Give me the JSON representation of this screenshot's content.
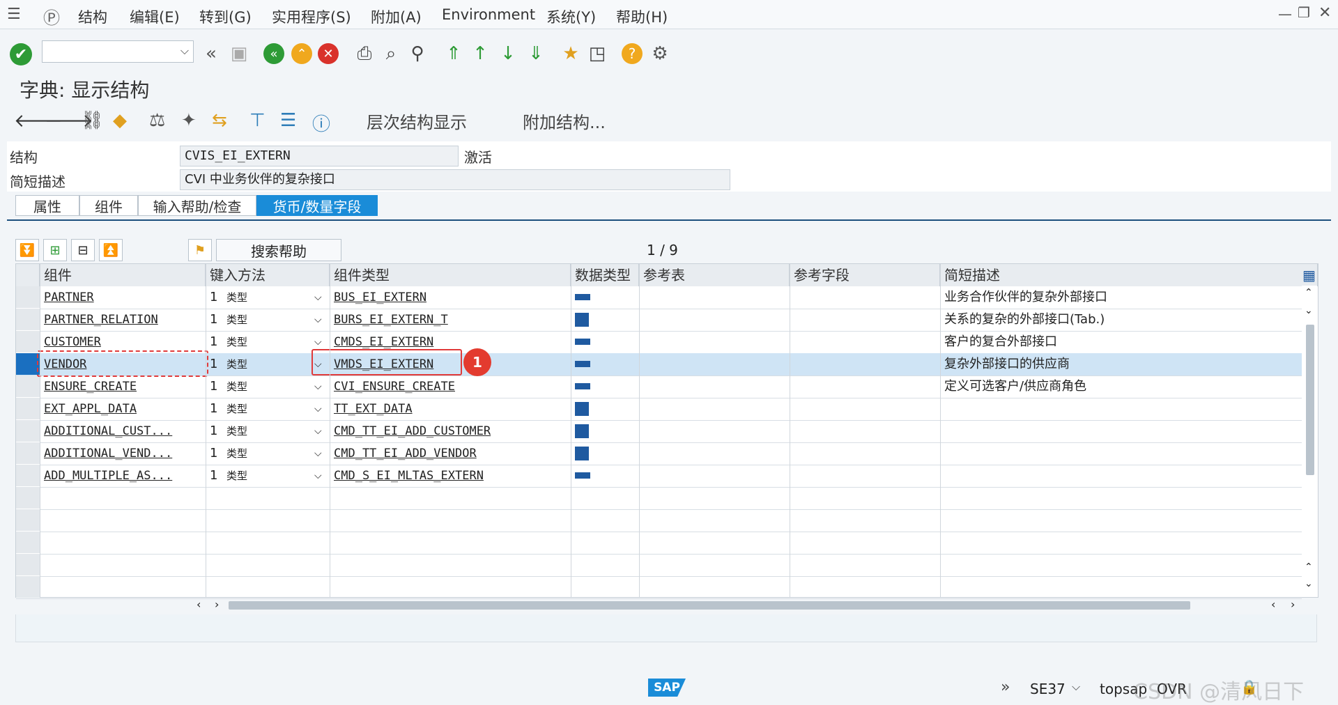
{
  "menu": {
    "items": [
      "结构",
      "编辑(E)",
      "转到(G)",
      "实用程序(S)",
      "附加(A)",
      "Environment",
      "系统(Y)",
      "帮助(H)"
    ]
  },
  "page_title": "字典: 显示结构",
  "app_toolbar": {
    "hierarchy_label": "层次结构显示",
    "append_label": "附加结构..."
  },
  "header": {
    "structure_label": "结构",
    "structure_value": "CVIS_EI_EXTERN",
    "status_value": "激活",
    "desc_label": "简短描述",
    "desc_value": "CVI 中业务伙伴的复杂接口"
  },
  "tabs": [
    {
      "label": "属性"
    },
    {
      "label": "组件"
    },
    {
      "label": "输入帮助/检查"
    },
    {
      "label": "货币/数量字段"
    }
  ],
  "table_toolbar": {
    "search_help_label": "搜索帮助",
    "pager": "1 / 9"
  },
  "columns": [
    "组件",
    "键入方法",
    "组件类型",
    "数据类型",
    "参考表",
    "参考字段",
    "简短描述"
  ],
  "rows": [
    {
      "component": "PARTNER",
      "method": "1",
      "method_text": "类型",
      "type": "BUS_EI_EXTERN",
      "datatype": "flat",
      "desc": "业务合作伙伴的复杂外部接口"
    },
    {
      "component": "PARTNER_RELATION",
      "method": "1",
      "method_text": "类型",
      "type": "BURS_EI_EXTERN_T",
      "datatype": "table",
      "desc": "关系的复杂的外部接口(Tab.)"
    },
    {
      "component": "CUSTOMER",
      "method": "1",
      "method_text": "类型",
      "type": "CMDS_EI_EXTERN",
      "datatype": "flat",
      "desc": "客户的复合外部接口"
    },
    {
      "component": "VENDOR",
      "method": "1",
      "method_text": "类型",
      "type": "VMDS_EI_EXTERN",
      "datatype": "flat",
      "desc": "复杂外部接口的供应商"
    },
    {
      "component": "ENSURE_CREATE",
      "method": "1",
      "method_text": "类型",
      "type": "CVI_ENSURE_CREATE",
      "datatype": "flat",
      "desc": "定义可选客户/供应商角色"
    },
    {
      "component": "EXT_APPL_DATA",
      "method": "1",
      "method_text": "类型",
      "type": "TT_EXT_DATA",
      "datatype": "table",
      "desc": ""
    },
    {
      "component": "ADDITIONAL_CUST...",
      "method": "1",
      "method_text": "类型",
      "type": "CMD_TT_EI_ADD_CUSTOMER",
      "datatype": "table",
      "desc": ""
    },
    {
      "component": "ADDITIONAL_VEND...",
      "method": "1",
      "method_text": "类型",
      "type": "CMD_TT_EI_ADD_VENDOR",
      "datatype": "table",
      "desc": ""
    },
    {
      "component": "ADD_MULTIPLE_AS...",
      "method": "1",
      "method_text": "类型",
      "type": "CMD_S_EI_MLTAS_EXTERN",
      "datatype": "flat",
      "desc": ""
    }
  ],
  "annotation_badge": "1",
  "status_bar": {
    "transaction": "SE37",
    "server": "topsap",
    "mode": "OVR",
    "brand": "SAP",
    "watermark": "CSDN @清风日下"
  },
  "colors": {
    "accent": "#1a8cd8",
    "selected_row": "#cfe4f5",
    "highlight": "#e03a3a"
  }
}
